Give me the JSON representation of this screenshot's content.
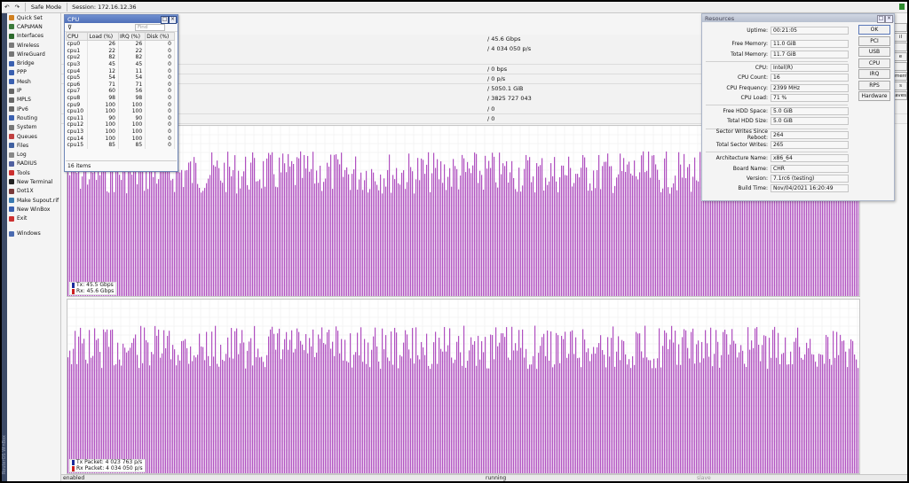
{
  "topbar": {
    "safe_mode": "Safe Mode",
    "session": "Session: 172.16.12.36"
  },
  "sidebar": {
    "items": [
      {
        "label": "Quick Set",
        "color": "#d08020"
      },
      {
        "label": "CAPsMAN",
        "color": "#3a7a3a"
      },
      {
        "label": "Interfaces",
        "color": "#2d6a2d"
      },
      {
        "label": "Wireless",
        "color": "#7a7a7a"
      },
      {
        "label": "WireGuard",
        "color": "#777777"
      },
      {
        "label": "Bridge",
        "color": "#3a60b0"
      },
      {
        "label": "PPP",
        "color": "#3a60b0"
      },
      {
        "label": "Mesh",
        "color": "#3a60b0"
      },
      {
        "label": "IP",
        "color": "#666666"
      },
      {
        "label": "MPLS",
        "color": "#666666"
      },
      {
        "label": "IPv6",
        "color": "#666666"
      },
      {
        "label": "Routing",
        "color": "#3a60b0"
      },
      {
        "label": "System",
        "color": "#777777"
      },
      {
        "label": "Queues",
        "color": "#c04040"
      },
      {
        "label": "Files",
        "color": "#4060a0"
      },
      {
        "label": "Log",
        "color": "#888888"
      },
      {
        "label": "RADIUS",
        "color": "#5060a0"
      },
      {
        "label": "Tools",
        "color": "#cc3030"
      },
      {
        "label": "New Terminal",
        "color": "#222222"
      },
      {
        "label": "Dot1X",
        "color": "#7a3a3a"
      },
      {
        "label": "Make Supout.rif",
        "color": "#3a7ab0"
      },
      {
        "label": "New WinBox",
        "color": "#3a60b0"
      },
      {
        "label": "Exit",
        "color": "#cc3030"
      }
    ],
    "windows_label": "Windows",
    "strip_label": "RouterOS WinBox"
  },
  "main_rows": [
    "/ 45.6 Gbps",
    "/ 4 034 050 p/s",
    "",
    "/ 0 bps",
    "/ 0 p/s",
    "/ 5050.1 GiB",
    "/ 3825 727 043",
    "/ 0",
    "/ 0"
  ],
  "cpu_window": {
    "title": "CPU",
    "find_placeholder": "Find",
    "columns": [
      "CPU",
      "Load (%)",
      "IRQ (%)",
      "Disk (%)"
    ],
    "rows": [
      [
        "cpu0",
        "26",
        "26",
        "0"
      ],
      [
        "cpu1",
        "22",
        "22",
        "0"
      ],
      [
        "cpu2",
        "82",
        "82",
        "0"
      ],
      [
        "cpu3",
        "45",
        "45",
        "0"
      ],
      [
        "cpu4",
        "12",
        "11",
        "0"
      ],
      [
        "cpu5",
        "54",
        "54",
        "0"
      ],
      [
        "cpu6",
        "71",
        "71",
        "0"
      ],
      [
        "cpu7",
        "60",
        "56",
        "0"
      ],
      [
        "cpu8",
        "98",
        "98",
        "0"
      ],
      [
        "cpu9",
        "100",
        "100",
        "0"
      ],
      [
        "cpu10",
        "100",
        "100",
        "0"
      ],
      [
        "cpu11",
        "90",
        "90",
        "0"
      ],
      [
        "cpu12",
        "100",
        "100",
        "0"
      ],
      [
        "cpu13",
        "100",
        "100",
        "0"
      ],
      [
        "cpu14",
        "100",
        "100",
        "0"
      ],
      [
        "cpu15",
        "85",
        "85",
        "0"
      ]
    ],
    "count": "16 items"
  },
  "resources": {
    "title": "Resources",
    "fields": [
      {
        "label": "Uptime:",
        "value": "00:21:05"
      },
      {
        "label": "Free Memory:",
        "value": "11.0 GiB"
      },
      {
        "label": "Total Memory:",
        "value": "11.7 GiB"
      },
      {
        "label": "CPU:",
        "value": "Intel(R)"
      },
      {
        "label": "CPU Count:",
        "value": "16"
      },
      {
        "label": "CPU Frequency:",
        "value": "2399 MHz"
      },
      {
        "label": "CPU Load:",
        "value": "71 %"
      },
      {
        "label": "Free HDD Space:",
        "value": "5.0 GiB"
      },
      {
        "label": "Total HDD Size:",
        "value": "5.0 GiB"
      },
      {
        "label": "Sector Writes Since Reboot:",
        "value": "264"
      },
      {
        "label": "Total Sector Writes:",
        "value": "265"
      },
      {
        "label": "Architecture Name:",
        "value": "x86_64"
      },
      {
        "label": "Board Name:",
        "value": "CHR"
      },
      {
        "label": "Version:",
        "value": "7.1rc6 (testing)"
      },
      {
        "label": "Build Time:",
        "value": "Nov/04/2021 16:20:49"
      }
    ],
    "buttons": [
      "OK",
      "PCI",
      "USB",
      "CPU",
      "IRQ",
      "RPS",
      "Hardware"
    ]
  },
  "right_edge_buttons": [
    "",
    "il",
    "",
    "e",
    "",
    "ment",
    "s",
    "aves"
  ],
  "graphs": {
    "traffic": {
      "tx_label": "Tx: 45.5 Gbps",
      "rx_label": "Rx: 45.6 Gbps",
      "tx_color": "#1a2a9a",
      "rx_color": "#cc2020",
      "bar_color": "#b050c0"
    },
    "packets": {
      "tx_label": "Tx Packet: 4 023 763 p/s",
      "rx_label": "Rx Packet: 4 034 050 p/s",
      "tx_color": "#1a2a9a",
      "rx_color": "#cc2020",
      "bar_color": "#b050c0"
    }
  },
  "statusbar": {
    "left": "enabled",
    "middle": "running",
    "right": "slave"
  }
}
